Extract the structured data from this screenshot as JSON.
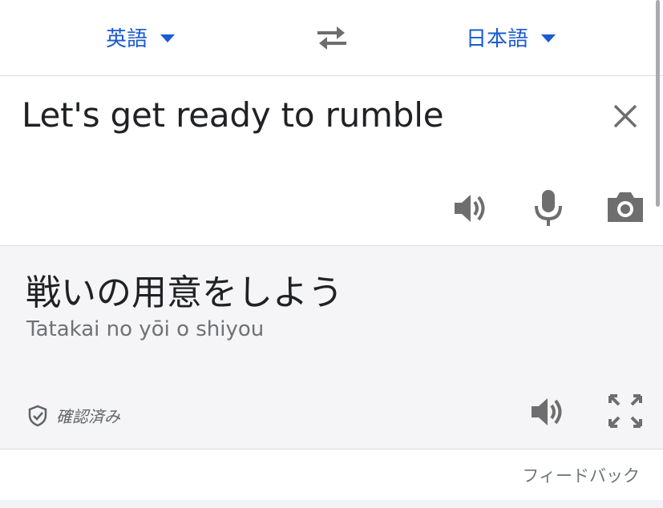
{
  "languages": {
    "source": "英語",
    "target": "日本語"
  },
  "source": {
    "text": "Let's get ready to rumble"
  },
  "result": {
    "text": "戦いの用意をしよう",
    "romanization": "Tatakai no yōi o shiyou",
    "verified_label": "確認済み"
  },
  "feedback_label": "フィードバック",
  "colors": {
    "accent": "#1a5bd1",
    "icon": "#6e6e6e",
    "result_background": "#f5f5f7"
  },
  "icons": [
    "swap-icon",
    "close-icon",
    "speaker-icon",
    "microphone-icon",
    "camera-icon",
    "shield-check-icon",
    "fullscreen-icon"
  ]
}
